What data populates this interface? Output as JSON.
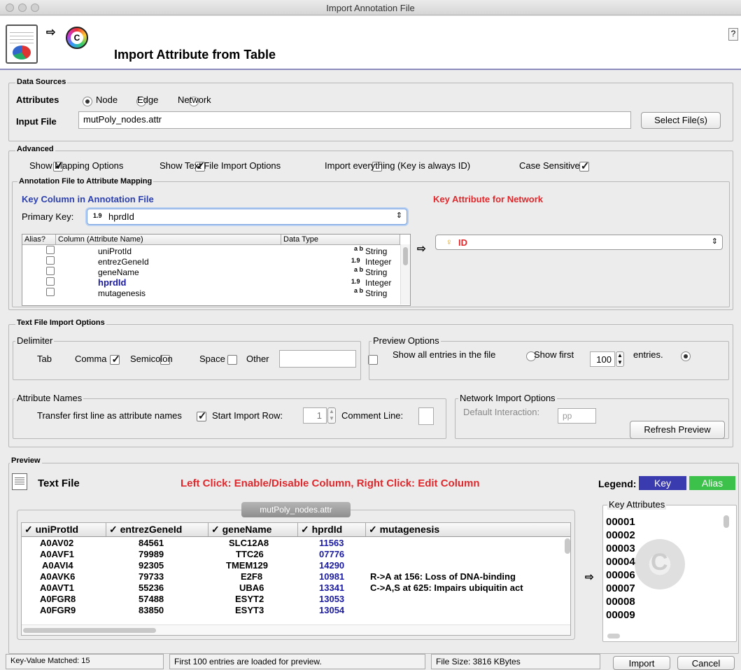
{
  "window": {
    "title": "Import Annotation File"
  },
  "header": {
    "title": "Import Attribute from Table",
    "help": "?"
  },
  "data_sources": {
    "label": "Data Sources",
    "attributes_label": "Attributes",
    "radios": [
      {
        "label": "Node",
        "selected": true
      },
      {
        "label": "Edge",
        "selected": false
      },
      {
        "label": "Network",
        "selected": false
      }
    ],
    "input_file_label": "Input File",
    "input_file_value": "mutPoly_nodes.attr",
    "select_button": "Select File(s)"
  },
  "advanced": {
    "label": "Advanced",
    "options": [
      {
        "label": "Show Mapping Options",
        "checked": true
      },
      {
        "label": "Show Text File Import Options",
        "checked": true
      },
      {
        "label": "Import everything (Key is always ID)",
        "checked": false
      },
      {
        "label": "Case Sensitive",
        "checked": true
      }
    ]
  },
  "mapping": {
    "label": "Annotation File to Attribute Mapping",
    "key_column_label": "Key Column in Annotation File",
    "key_attr_label": "Key Attribute for Network",
    "primary_key_label": "Primary Key:",
    "primary_key_type": "1.9",
    "primary_key_value": "hprdId",
    "columns_header": [
      "Alias?",
      "Column (Attribute Name)",
      "Data Type"
    ],
    "columns": [
      {
        "name": "uniProtId",
        "type_icon": "a b",
        "type": "String",
        "highlight": false
      },
      {
        "name": "entrezGeneId",
        "type_icon": "1.9",
        "type": "Integer",
        "highlight": false
      },
      {
        "name": "geneName",
        "type_icon": "a b",
        "type": "String",
        "highlight": false
      },
      {
        "name": "hprdId",
        "type_icon": "1.9",
        "type": "Integer",
        "highlight": true
      },
      {
        "name": "mutagenesis",
        "type_icon": "a b",
        "type": "String",
        "highlight": false
      }
    ],
    "network_key_value": "ID"
  },
  "text_import": {
    "label": "Text File Import Options",
    "delimiter_label": "Delimiter",
    "delimiters": [
      {
        "label": "Tab",
        "checked": true
      },
      {
        "label": "Comma",
        "checked": false
      },
      {
        "label": "Semicolon",
        "checked": false
      },
      {
        "label": "Space",
        "checked": false
      },
      {
        "label": "Other",
        "checked": false
      }
    ],
    "other_value": "",
    "preview_options_label": "Preview Options",
    "show_all_label": "Show all entries in the file",
    "show_first_label": "Show first",
    "show_first_value": "100",
    "entries_label": "entries.",
    "attr_names_label": "Attribute Names",
    "transfer_label": "Transfer first line as attribute names",
    "start_row_label": "Start Import Row:",
    "start_row_value": "1",
    "comment_label": "Comment Line:",
    "comment_value": "",
    "network_import_label": "Network Import Options",
    "default_interaction_label": "Default Interaction:",
    "default_interaction_value": "pp",
    "refresh_button": "Refresh Preview"
  },
  "preview": {
    "label": "Preview",
    "text_file_label": "Text File",
    "instructions": "Left Click: Enable/Disable Column, Right Click: Edit Column",
    "legend_label": "Legend:",
    "legend_key": "Key",
    "legend_alias": "Alias",
    "tab_label": "mutPoly_nodes.attr",
    "headers": [
      "uniProtId",
      "entrezGeneId",
      "geneName",
      "hprdId",
      "mutagenesis"
    ],
    "rows": [
      [
        "A0AV02",
        "84561",
        "SLC12A8",
        "11563",
        ""
      ],
      [
        "A0AVF1",
        "79989",
        "TTC26",
        "07776",
        ""
      ],
      [
        "A0AVI4",
        "92305",
        "TMEM129",
        "14290",
        ""
      ],
      [
        "A0AVK6",
        "79733",
        "E2F8",
        "10981",
        "R->A at 156: Loss of DNA-binding"
      ],
      [
        "A0AVT1",
        "55236",
        "UBA6",
        "13341",
        "C->A,S at 625: Impairs ubiquitin act"
      ],
      [
        "A0FGR8",
        "57488",
        "ESYT2",
        "13053",
        ""
      ],
      [
        "A0FGR9",
        "83850",
        "ESYT3",
        "13054",
        ""
      ]
    ],
    "key_attrs_label": "Key Attributes",
    "key_attrs": [
      "00001",
      "00002",
      "00003",
      "00004",
      "00006",
      "00007",
      "00008",
      "00009"
    ]
  },
  "status": {
    "matched": "Key-Value Matched: 15",
    "message": "First 100 entries are loaded for preview.",
    "file_size": "File Size: 3816 KBytes",
    "import_button": "Import",
    "cancel_button": "Cancel"
  },
  "colors": {
    "key": "#3b3bb0",
    "alias": "#3cc24a",
    "red_label": "#e0282c",
    "blue_label": "#2b3fae",
    "hprd": "#1a1aa0"
  }
}
